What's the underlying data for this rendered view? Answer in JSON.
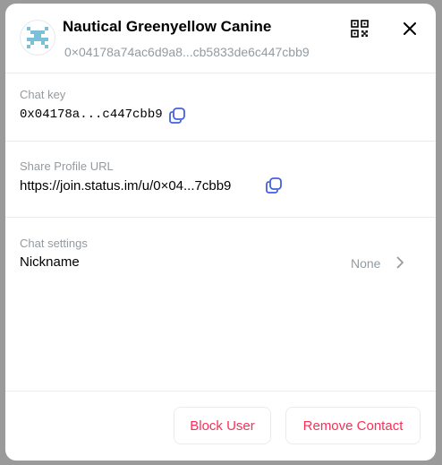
{
  "profile": {
    "name": "Nautical Greenyellow Canine",
    "public_key_short": "0×04178a74ac6d9a8...cb5833de6c447cbb9"
  },
  "chat_key": {
    "label": "Chat key",
    "value": "0x04178a...c447cbb9"
  },
  "share_url": {
    "label": "Share Profile URL",
    "value": "https://join.status.im/u/0×04...7cbb9"
  },
  "chat_settings": {
    "label": "Chat settings",
    "nickname_label": "Nickname",
    "nickname_value": "None"
  },
  "footer": {
    "block_label": "Block User",
    "remove_label": "Remove Contact"
  },
  "colors": {
    "accent": "#4360df",
    "danger": "#ff2d55",
    "muted": "#939ba1",
    "avatar": "#7ac0d6"
  },
  "icons": [
    "qr-code-icon",
    "close-icon",
    "copy-icon",
    "chevron-right-icon"
  ]
}
